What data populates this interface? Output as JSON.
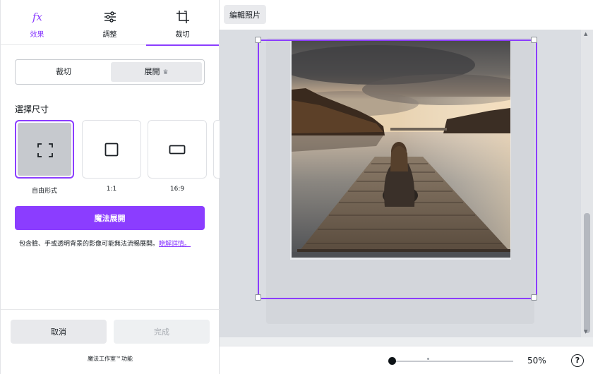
{
  "tabs": [
    {
      "label": "效果",
      "icon": "fx-icon"
    },
    {
      "label": "調整",
      "icon": "sliders-icon"
    },
    {
      "label": "裁切",
      "icon": "crop-icon"
    }
  ],
  "active_tab": "裁切",
  "mode_toggle": {
    "crop": "裁切",
    "expand": "展開",
    "expand_badge": "♛"
  },
  "size_section": {
    "title": "選擇尺寸",
    "options": [
      {
        "label": "自由形式",
        "icon": "freeform-icon",
        "selected": true
      },
      {
        "label": "1:1",
        "icon": "square-icon",
        "selected": false
      },
      {
        "label": "16:9",
        "icon": "wide-rect-icon",
        "selected": false
      }
    ]
  },
  "magic_button": "魔法展開",
  "note": {
    "text": "包含臉、手或透明背景的影像可能無法流暢展開。",
    "link": "瞭解詳情。"
  },
  "buttons": {
    "cancel": "取消",
    "done": "完成"
  },
  "studio_text": "魔法工作室™功能",
  "toolbar": {
    "edit_photo": "編輯照片"
  },
  "zoom": {
    "label": "50%",
    "value": 50
  },
  "help": "?",
  "colors": {
    "accent": "#8b3dff",
    "canvas": "#dadde2"
  }
}
